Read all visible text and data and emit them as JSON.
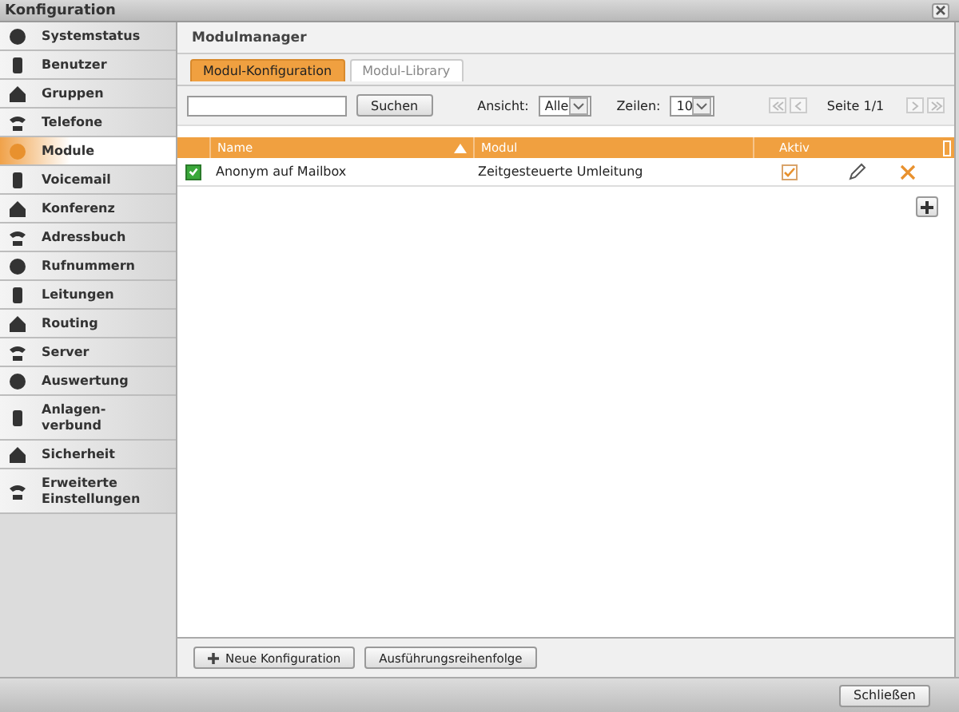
{
  "window": {
    "title": "Konfiguration"
  },
  "sidebar": {
    "items": [
      {
        "label": "Systemstatus",
        "selected": false
      },
      {
        "label": "Benutzer",
        "selected": false
      },
      {
        "label": "Gruppen",
        "selected": false
      },
      {
        "label": "Telefone",
        "selected": false
      },
      {
        "label": "Module",
        "selected": true
      },
      {
        "label": "Voicemail",
        "selected": false
      },
      {
        "label": "Konferenz",
        "selected": false
      },
      {
        "label": "Adressbuch",
        "selected": false
      },
      {
        "label": "Rufnummern",
        "selected": false
      },
      {
        "label": "Leitungen",
        "selected": false
      },
      {
        "label": "Routing",
        "selected": false
      },
      {
        "label": "Server",
        "selected": false
      },
      {
        "label": "Auswertung",
        "selected": false
      },
      {
        "label": "Anlagen-\nverbund",
        "selected": false
      },
      {
        "label": "Sicherheit",
        "selected": false
      },
      {
        "label": "Erweiterte\nEinstellungen",
        "selected": false
      }
    ]
  },
  "panel": {
    "title": "Modulmanager"
  },
  "tabs": [
    {
      "label": "Modul-Konfiguration",
      "selected": true
    },
    {
      "label": "Modul-Library",
      "selected": false
    }
  ],
  "toolbar": {
    "search_button": "Suchen",
    "view_label": "Ansicht:",
    "view_value": "Alle",
    "rows_label": "Zeilen:",
    "rows_value": "10",
    "page": "Seite 1/1"
  },
  "table": {
    "columns": [
      "Name",
      "Modul",
      "Aktiv"
    ],
    "rows": [
      {
        "checked": true,
        "name": "Anonym auf Mailbox",
        "module": "Zeitgesteuerte Umleitung",
        "active": true
      }
    ]
  },
  "footer_buttons": [
    "Neue Konfiguration",
    "Ausführungsreihenfolge"
  ],
  "close_button": "Schließen"
}
